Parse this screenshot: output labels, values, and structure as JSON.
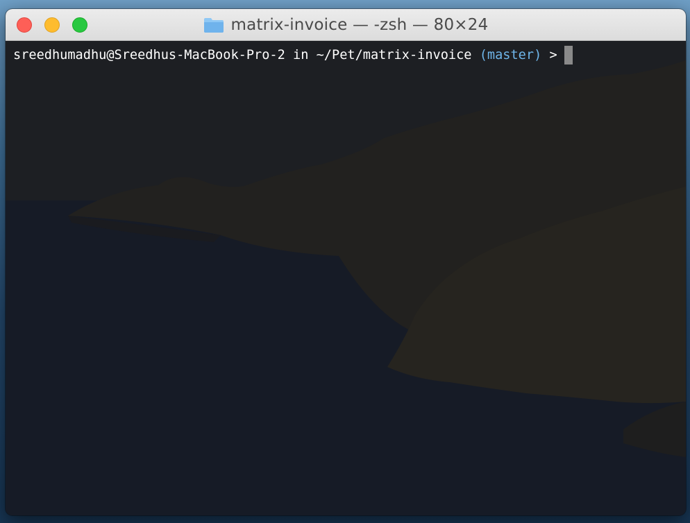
{
  "window": {
    "title": "matrix-invoice — -zsh — 80×24"
  },
  "titlebar": {
    "buttons": [
      {
        "name": "close",
        "color": "#fe5f57"
      },
      {
        "name": "minimize",
        "color": "#febc2e"
      },
      {
        "name": "zoom",
        "color": "#28c840"
      }
    ],
    "icon": "folder-icon"
  },
  "terminal": {
    "prompt": {
      "user_host": "sreedhumadhu@Sreedhus-MacBook-Pro-2",
      "in": "in",
      "path": "~/Pet/matrix-invoice",
      "branch": "(master)",
      "symbol": ">"
    },
    "colors": {
      "background": "#1c1e22",
      "text": "#ffffff",
      "branch": "#6fb6ea"
    }
  }
}
